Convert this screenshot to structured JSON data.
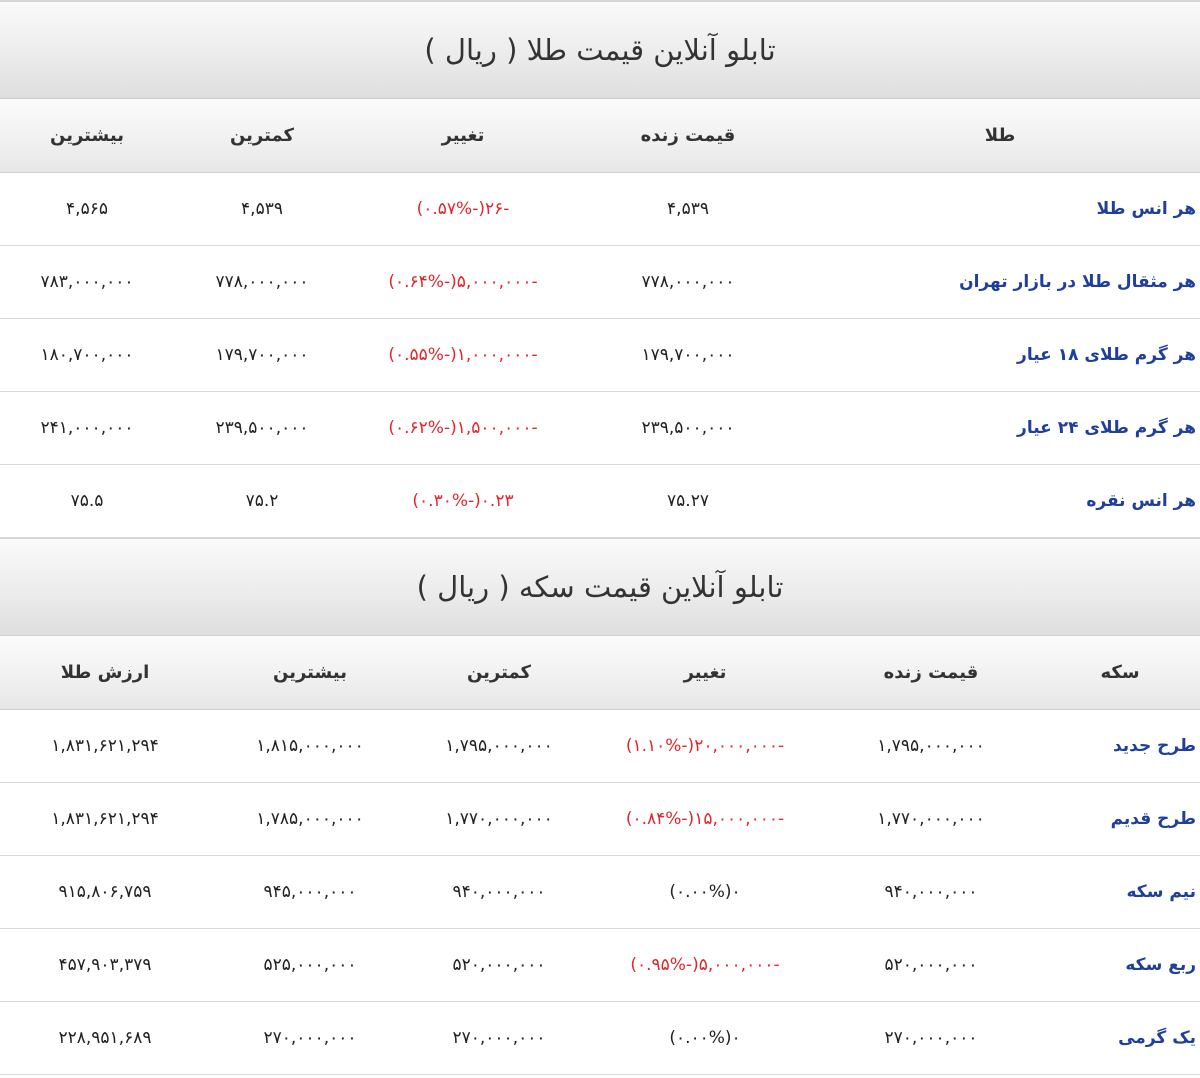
{
  "gold_board": {
    "title": "تابلو آنلاین قیمت طلا ( ریال )",
    "headers": {
      "name": "طلا",
      "live": "قیمت زنده",
      "change": "تغییر",
      "min": "کمترین",
      "max": "بیشترین"
    },
    "rows": [
      {
        "name": "هر انس طلا",
        "live": "۴,۵۳۹",
        "change": "-۲۶(-۰.۵۷%)",
        "min": "۴,۵۳۹",
        "max": "۴,۵۶۵"
      },
      {
        "name": "هر مثقال طلا در بازار تهران",
        "live": "۷۷۸,۰۰۰,۰۰۰",
        "change": "-۵,۰۰۰,۰۰۰(-۰.۶۴%)",
        "min": "۷۷۸,۰۰۰,۰۰۰",
        "max": "۷۸۳,۰۰۰,۰۰۰"
      },
      {
        "name": "هر گرم طلای ۱۸ عیار",
        "live": "۱۷۹,۷۰۰,۰۰۰",
        "change": "-۱,۰۰۰,۰۰۰(-۰.۵۵%)",
        "min": "۱۷۹,۷۰۰,۰۰۰",
        "max": "۱۸۰,۷۰۰,۰۰۰"
      },
      {
        "name": "هر گرم طلای ۲۴ عیار",
        "live": "۲۳۹,۵۰۰,۰۰۰",
        "change": "-۱,۵۰۰,۰۰۰(-۰.۶۲%)",
        "min": "۲۳۹,۵۰۰,۰۰۰",
        "max": "۲۴۱,۰۰۰,۰۰۰"
      },
      {
        "name": "هر انس نقره",
        "live": "۷۵.۲۷",
        "change": "۰.۲۳(-۰.۳۰%)",
        "min": "۷۵.۲",
        "max": "۷۵.۵"
      }
    ]
  },
  "coin_board": {
    "title": "تابلو آنلاین قیمت سکه ( ریال )",
    "headers": {
      "name": "سکه",
      "live": "قیمت زنده",
      "change": "تغییر",
      "min": "کمترین",
      "max": "بیشترین",
      "gold_value": "ارزش طلا"
    },
    "rows": [
      {
        "name": "طرح جدید",
        "live": "۱,۷۹۵,۰۰۰,۰۰۰",
        "change": "-۲۰,۰۰۰,۰۰۰(-۱.۱۰%)",
        "min": "۱,۷۹۵,۰۰۰,۰۰۰",
        "max": "۱,۸۱۵,۰۰۰,۰۰۰",
        "gold_value": "۱,۸۳۱,۶۲۱,۲۹۴"
      },
      {
        "name": "طرح قدیم",
        "live": "۱,۷۷۰,۰۰۰,۰۰۰",
        "change": "-۱۵,۰۰۰,۰۰۰(-۰.۸۴%)",
        "min": "۱,۷۷۰,۰۰۰,۰۰۰",
        "max": "۱,۷۸۵,۰۰۰,۰۰۰",
        "gold_value": "۱,۸۳۱,۶۲۱,۲۹۴"
      },
      {
        "name": "نیم سکه",
        "live": "۹۴۰,۰۰۰,۰۰۰",
        "change": "۰(۰.۰۰%)",
        "min": "۹۴۰,۰۰۰,۰۰۰",
        "max": "۹۴۵,۰۰۰,۰۰۰",
        "gold_value": "۹۱۵,۸۰۶,۷۵۹"
      },
      {
        "name": "ربع سکه",
        "live": "۵۲۰,۰۰۰,۰۰۰",
        "change": "-۵,۰۰۰,۰۰۰(-۰.۹۵%)",
        "min": "۵۲۰,۰۰۰,۰۰۰",
        "max": "۵۲۵,۰۰۰,۰۰۰",
        "gold_value": "۴۵۷,۹۰۳,۳۷۹"
      },
      {
        "name": "یک گرمی",
        "live": "۲۷۰,۰۰۰,۰۰۰",
        "change": "۰(۰.۰۰%)",
        "min": "۲۷۰,۰۰۰,۰۰۰",
        "max": "۲۷۰,۰۰۰,۰۰۰",
        "gold_value": "۲۲۸,۹۵۱,۶۸۹"
      }
    ]
  },
  "colors": {
    "name_link": "#1f3f9a",
    "change_negative": "#e2262b"
  }
}
